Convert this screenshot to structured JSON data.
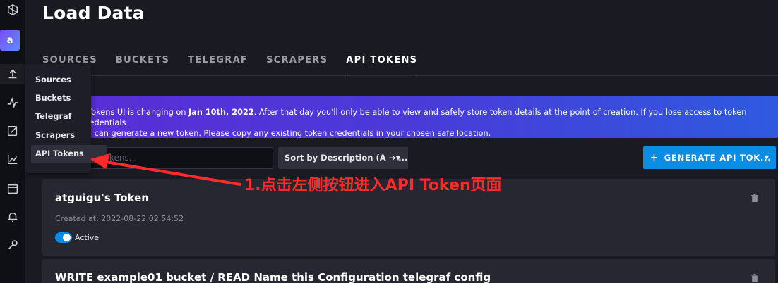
{
  "avatar_letter": "a",
  "page_title": "Load Data",
  "tabs": [
    {
      "label": "SOURCES"
    },
    {
      "label": "BUCKETS"
    },
    {
      "label": "TELEGRAF"
    },
    {
      "label": "SCRAPERS"
    },
    {
      "label": "API TOKENS",
      "active": true
    }
  ],
  "banner": {
    "prefix": "r Tokens UI is changing on ",
    "date": "Jan 10th, 2022",
    "line1_rest": ". After that day you'll only be able to view and safely store token details at the point of creation. If you lose access to token credentials",
    "line2": "ou can generate a new token. Please copy any existing token credentials in your chosen safe location."
  },
  "filter": {
    "placeholder": "kens..."
  },
  "sort": {
    "label": "Sort by Description (A → ..."
  },
  "generate_button": {
    "label": "GENERATE API TOK...",
    "plus": "+"
  },
  "tokens": [
    {
      "title": "atguigu's Token",
      "created": "Created at: 2022-08-22 02:54:52",
      "status": "Active"
    },
    {
      "title": "WRITE example01 bucket / READ Name this Configuration telegraf config"
    }
  ],
  "popup_menu": {
    "items": [
      "Sources",
      "Buckets",
      "Telegraf",
      "Scrapers",
      "API Tokens"
    ],
    "highlighted": "API Tokens"
  },
  "annotation": {
    "text": "1.点击左侧按钮进入API Token页面",
    "color": "#ff2a2a"
  },
  "colors": {
    "accent": "#0b8de4",
    "background": "#1a1a22",
    "card": "#262730"
  },
  "rail_icons": [
    "logo-icon",
    "upload-icon",
    "data-explorer-icon",
    "notebook-icon",
    "chart-icon",
    "calendar-icon",
    "bell-icon",
    "wrench-icon"
  ]
}
